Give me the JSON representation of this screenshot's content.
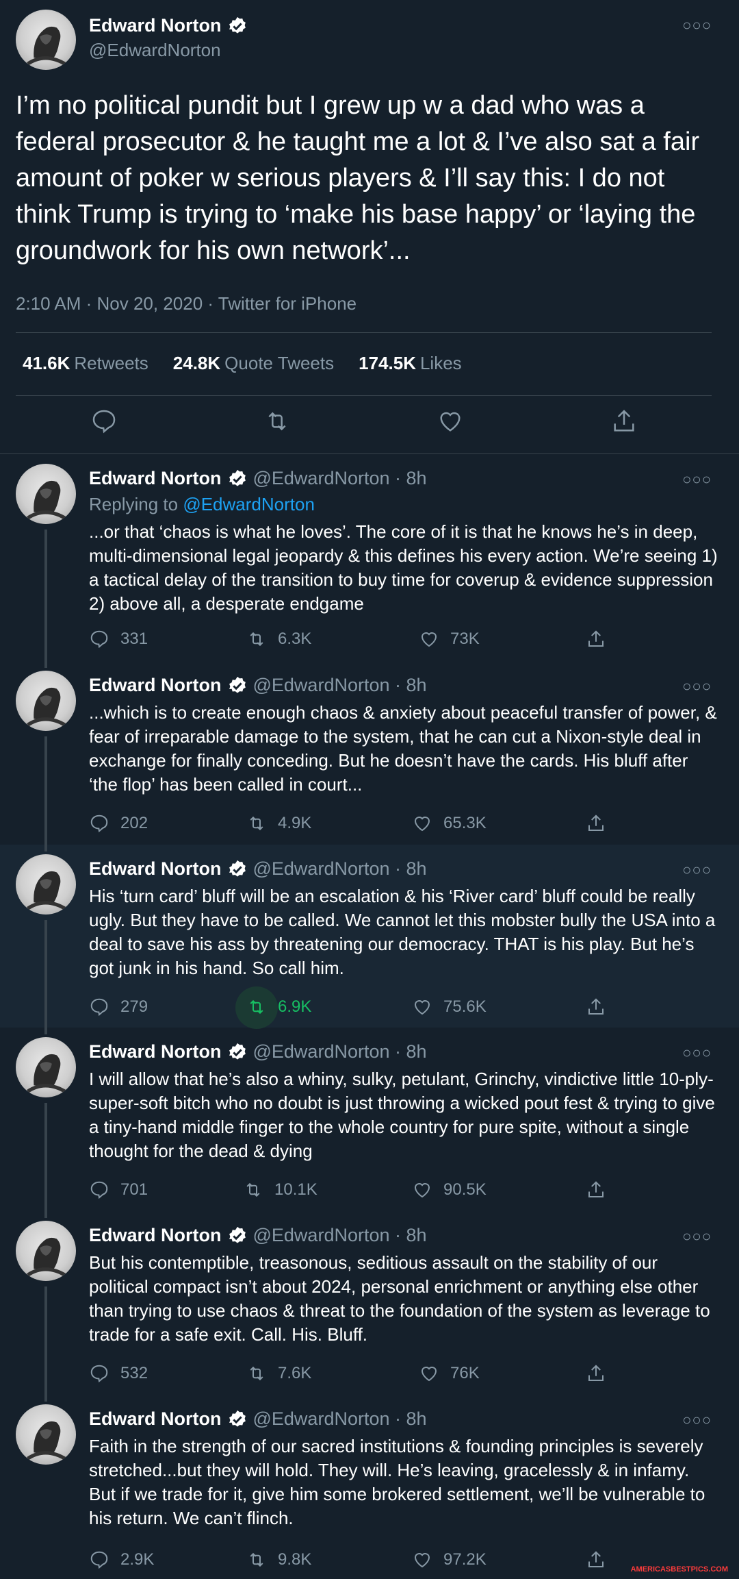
{
  "main_tweet": {
    "name": "Edward Norton",
    "handle": "@EdwardNorton",
    "text": "I’m no political pundit but I grew up w a dad who was a federal prosecutor & he taught me a lot & I’ve also sat a fair amount of poker w serious players & I’ll say this: I do not think Trump is trying to ‘make his base happy’ or ‘laying the groundwork for his own network’...",
    "meta": "2:10 AM · Nov 20, 2020 · Twitter for iPhone",
    "retweets_count": "41.6K",
    "retweets_label": "Retweets",
    "quotes_count": "24.8K",
    "quotes_label": "Quote Tweets",
    "likes_count": "174.5K",
    "likes_label": "Likes"
  },
  "replies": [
    {
      "name": "Edward Norton",
      "handle": "@EdwardNorton · 8h",
      "replying_prefix": "Replying to",
      "replying_to": "@EdwardNorton",
      "text": "...or that ‘chaos is what he loves’. The core of it is that he knows he’s in deep, multi-dimensional legal jeopardy & this defines his every action. We’re seeing 1) a tactical delay of the transition to buy time for coverup & evidence suppression 2) above all, a desperate endgame",
      "replies": "331",
      "retweets": "6.3K",
      "likes": "73K"
    },
    {
      "name": "Edward Norton",
      "handle": "@EdwardNorton · 8h",
      "text": "...which is to create enough chaos & anxiety about peaceful transfer of power, & fear of irreparable damage to the system, that he can cut a Nixon-style deal in exchange for finally conceding. But he doesn’t have the cards. His bluff after ‘the flop’ has been called in court...",
      "replies": "202",
      "retweets": "4.9K",
      "likes": "65.3K"
    },
    {
      "name": "Edward Norton",
      "handle": "@EdwardNorton · 8h",
      "text": "His ‘turn card’ bluff will be an escalation & his ‘River card’ bluff could be really ugly. But they have to be called. We cannot let this mobster bully the USA into a deal to save his ass by threatening our democracy. THAT is his play. But he’s got junk in his hand. So call him.",
      "replies": "279",
      "retweets": "6.9K",
      "likes": "75.6K"
    },
    {
      "name": "Edward Norton",
      "handle": "@EdwardNorton · 8h",
      "text": "I will allow that he’s also a whiny, sulky, petulant, Grinchy, vindictive little 10-ply-super-soft bitch who no doubt is just throwing a wicked pout fest & trying to give a tiny-hand middle finger to the whole country for pure spite, without a single thought for the dead & dying",
      "replies": "701",
      "retweets": "10.1K",
      "likes": "90.5K"
    },
    {
      "name": "Edward Norton",
      "handle": "@EdwardNorton · 8h",
      "text": "But his contemptible, treasonous, seditious assault on the stability of our political compact isn’t about 2024, personal enrichment or anything else other than trying to use chaos & threat to the foundation of the system as leverage to trade for a safe exit. Call. His. Bluff.",
      "replies": "532",
      "retweets": "7.6K",
      "likes": "76K"
    },
    {
      "name": "Edward Norton",
      "handle": "@EdwardNorton · 8h",
      "text": "Faith in the strength of our sacred institutions & founding principles is severely stretched...but they will hold. They will. He’s leaving, gracelessly & in infamy. But if we trade for it, give him some brokered settlement, we’ll be vulnerable to his return. We can’t flinch.",
      "replies": "2.9K",
      "retweets": "9.8K",
      "likes": "97.2K"
    }
  ],
  "colors": {
    "background": "#15202b",
    "highlight": "#192734",
    "secondary_text": "#8899a6",
    "link": "#1da1f2",
    "retweet_active": "#17bf63",
    "verified": "#1da1f2"
  },
  "watermark": "AMERICASBESTPICS.COM"
}
